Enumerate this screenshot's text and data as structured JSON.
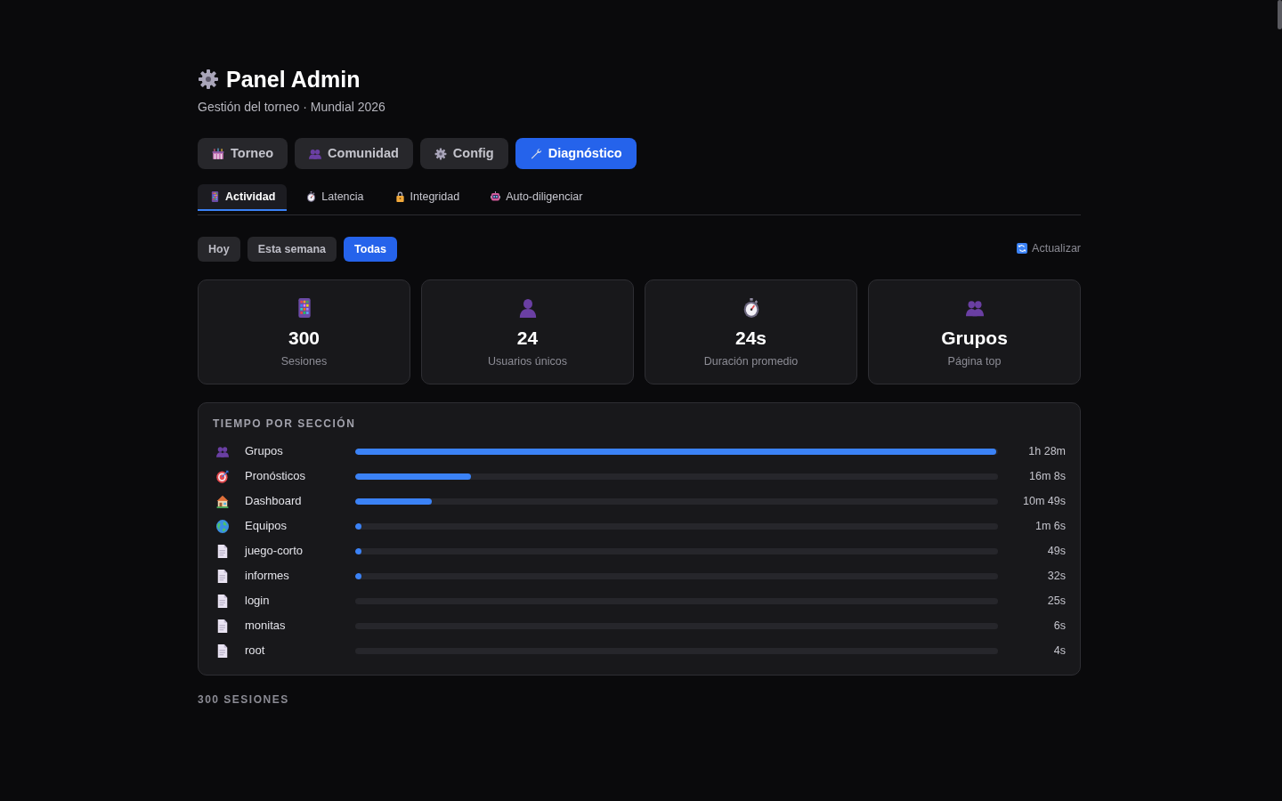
{
  "header": {
    "title": "Panel Admin",
    "subtitle": "Gestión del torneo · Mundial 2026"
  },
  "main_tabs": [
    {
      "label": "Torneo",
      "selected": false
    },
    {
      "label": "Comunidad",
      "selected": false
    },
    {
      "label": "Config",
      "selected": false
    },
    {
      "label": "Diagnóstico",
      "selected": true
    }
  ],
  "sub_tabs": [
    {
      "label": "Actividad",
      "selected": true
    },
    {
      "label": "Latencia",
      "selected": false
    },
    {
      "label": "Integridad",
      "selected": false
    },
    {
      "label": "Auto-diligenciar",
      "selected": false
    }
  ],
  "filters": [
    {
      "label": "Hoy",
      "selected": false
    },
    {
      "label": "Esta semana",
      "selected": false
    },
    {
      "label": "Todas",
      "selected": true
    }
  ],
  "refresh_button": {
    "label": "Actualizar"
  },
  "stats": [
    {
      "value": "300",
      "label": "Sesiones"
    },
    {
      "value": "24",
      "label": "Usuarios únicos"
    },
    {
      "value": "24s",
      "label": "Duración promedio"
    },
    {
      "value": "Grupos",
      "label": "Página top"
    }
  ],
  "time_by_section": {
    "title": "TIEMPO POR SECCIÓN",
    "rows": [
      {
        "name": "Grupos",
        "level": 1,
        "reading": "1h 28m"
      },
      {
        "name": "Pronósticos",
        "level": 0.18,
        "reading": "16m 8s"
      },
      {
        "name": "Dashboard",
        "level": 0.12,
        "reading": "10m 49s"
      },
      {
        "name": "Equipos",
        "level": 0.01,
        "reading": "1m 6s"
      },
      {
        "name": "juego-corto",
        "level": 0.01,
        "reading": "49s"
      },
      {
        "name": "informes",
        "level": 0.01,
        "reading": "32s"
      },
      {
        "name": "login",
        "reading": "25s"
      },
      {
        "name": "monitas",
        "reading": "6s"
      },
      {
        "name": "root",
        "reading": "4s"
      }
    ]
  },
  "sessions_heading": "300 SESIONES"
}
